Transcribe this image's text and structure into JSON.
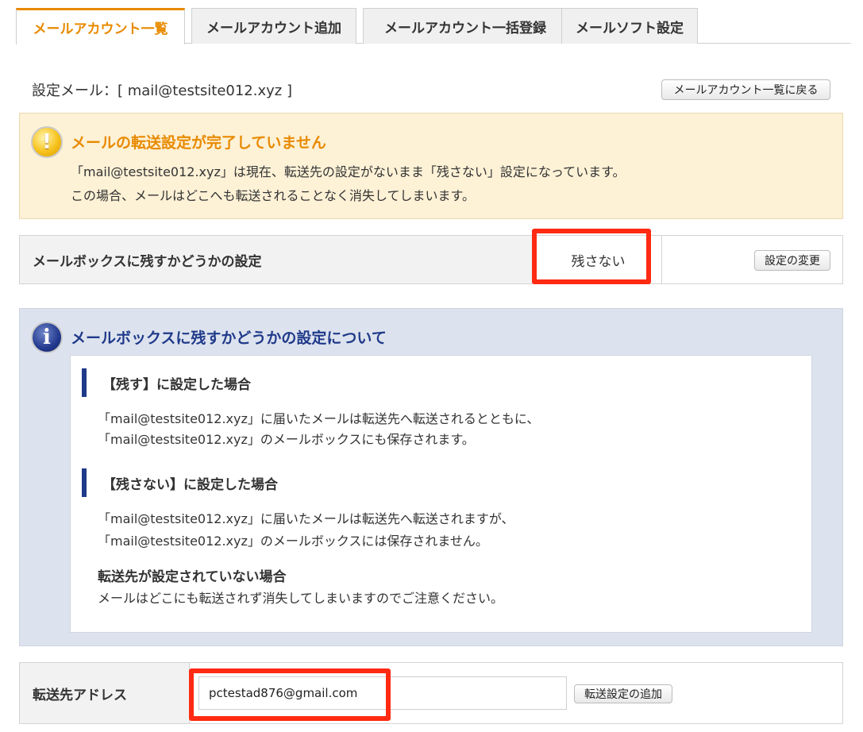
{
  "tabs": [
    {
      "label": "メールアカウント一覧"
    },
    {
      "label": "メールアカウント追加"
    },
    {
      "label": "メールアカウント一括登録"
    },
    {
      "label": "メールソフト設定"
    }
  ],
  "setting_mail": "設定メール：[ mail@testsite012.xyz ]",
  "back_button": "メールアカウント一覧に戻る",
  "warning": {
    "title": "メールの転送設定が完了していません",
    "line1": "「mail@testsite012.xyz」は現在、転送先の設定がないまま「残さない」設定になっています。",
    "line2": "この場合、メールはどこへも転送されることなく消失してしまいます。"
  },
  "mailbox": {
    "label": "メールボックスに残すかどうかの設定",
    "value": "残さない",
    "change_button": "設定の変更"
  },
  "info": {
    "title": "メールボックスに残すかどうかの設定について",
    "keep_heading": "【残す】に設定した場合",
    "keep_line1": "「mail@testsite012.xyz」に届いたメールは転送先へ転送されるとともに、",
    "keep_line2": "「mail@testsite012.xyz」のメールボックスにも保存されます。",
    "nokeep_heading": "【残さない】に設定した場合",
    "nokeep_line1": "「mail@testsite012.xyz」に届いたメールは転送先へ転送されますが、",
    "nokeep_line2": "「mail@testsite012.xyz」のメールボックスには保存されません。",
    "note_heading": "転送先が設定されていない場合",
    "note_line": "メールはどこにも転送されず消失してしまいますのでご注意ください。"
  },
  "forward": {
    "label": "転送先アドレス",
    "value": "pctestad876@gmail.com",
    "add_button": "転送設定の追加"
  },
  "colors": {
    "accent_orange": "#e88a00",
    "info_blue": "#1f3a8a",
    "highlight_red": "#ff2a12",
    "warning_bg": "#fdf1d6",
    "info_bg": "#dde3ee"
  }
}
